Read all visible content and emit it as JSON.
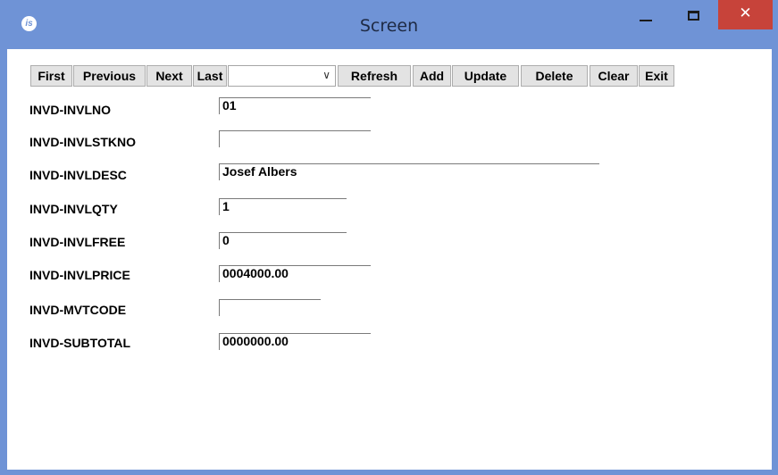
{
  "window": {
    "title": "Screen",
    "icon_text": "is",
    "controls": {
      "minimize_icon": "minimize-icon",
      "maximize_icon": "maximize-icon",
      "close_label": "✕"
    }
  },
  "toolbar": {
    "first": "First",
    "previous": "Previous",
    "next": "Next",
    "last": "Last",
    "combo_value": "",
    "combo_arrow": "∨",
    "refresh": "Refresh",
    "add": "Add",
    "update": "Update",
    "delete": "Delete",
    "clear": "Clear",
    "exit": "Exit"
  },
  "fields": [
    {
      "label": "INVD-INVLNO",
      "value": "01"
    },
    {
      "label": "INVD-INVLSTKNO",
      "value": ""
    },
    {
      "label": "INVD-INVLDESC",
      "value": "Josef Albers"
    },
    {
      "label": "INVD-INVLQTY",
      "value": "1"
    },
    {
      "label": "INVD-INVLFREE",
      "value": "0"
    },
    {
      "label": "INVD-INVLPRICE",
      "value": "0004000.00"
    },
    {
      "label": "INVD-MVTCODE",
      "value": ""
    },
    {
      "label": "INVD-SUBTOTAL",
      "value": "0000000.00"
    }
  ]
}
